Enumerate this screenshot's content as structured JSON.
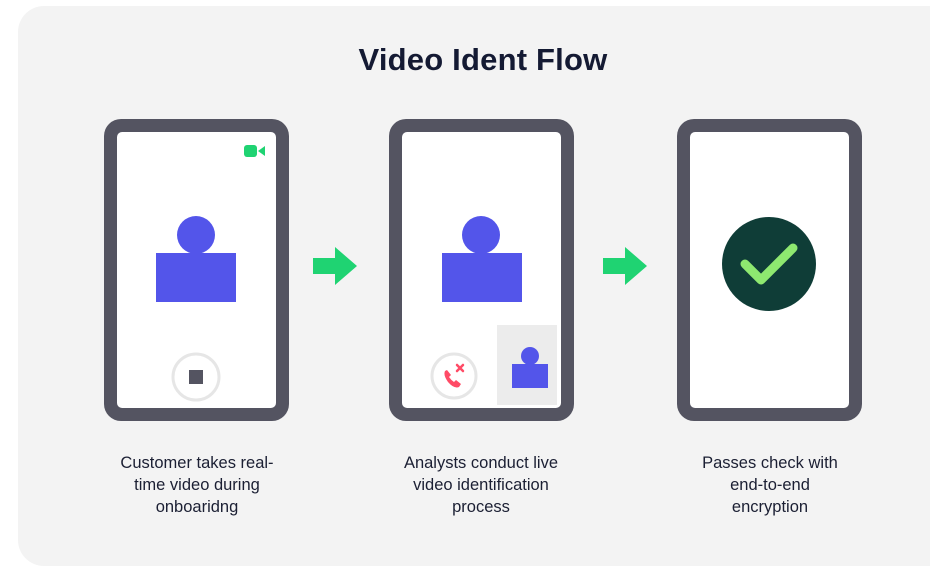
{
  "title": "Video Ident Flow",
  "steps": [
    {
      "caption_lines": [
        "Customer takes real-",
        "time video during",
        "onboaridng"
      ],
      "icon": "customer-recording-phone"
    },
    {
      "caption_lines": [
        "Analysts conduct live",
        "video identification",
        "process"
      ],
      "icon": "analyst-video-call-phone"
    },
    {
      "caption_lines": [
        "Passes check with",
        "end-to-end",
        "encryption"
      ],
      "icon": "success-check-phone"
    }
  ],
  "colors": {
    "background": "#f3f3f3",
    "phone_frame": "#545461",
    "person": "#5355ea",
    "arrow": "#1fd372",
    "check_circle": "#0f3d37",
    "check_mark": "#8ee870",
    "hangup": "#ff4b66"
  }
}
